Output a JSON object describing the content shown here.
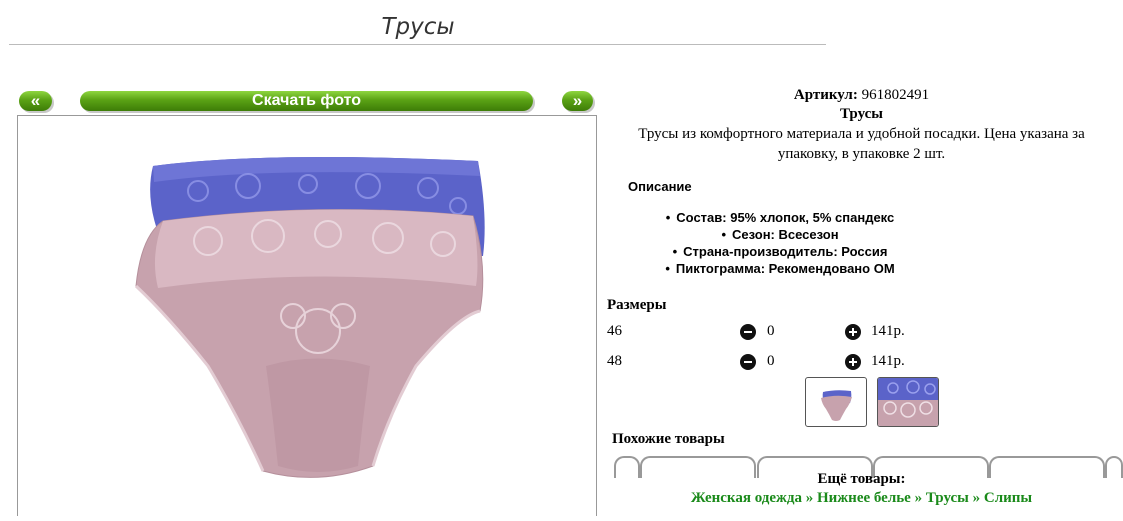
{
  "page": {
    "title": "Трусы"
  },
  "gallery": {
    "prev_label": "«",
    "download_label": "Скачать фото",
    "next_label": "»"
  },
  "product": {
    "article_label": "Артикул:",
    "article_value": "961802491",
    "name": "Трусы",
    "description": "Трусы из комфортного материала и удобной посадки. Цена указана за упаковку, в упаковке 2 шт.",
    "description_heading": "Описание",
    "properties": [
      "Состав: 95% хлопок, 5% спандекс",
      "Сезон: Всесезон",
      "Страна-производитель: Россия",
      "Пиктограмма: Рекомендовано ОМ"
    ]
  },
  "sizes": {
    "heading": "Размеры",
    "rows": [
      {
        "size": "46",
        "qty": "0",
        "price": "141р."
      },
      {
        "size": "48",
        "qty": "0",
        "price": "141р."
      }
    ]
  },
  "similar": {
    "heading": "Похожие товары"
  },
  "more": {
    "heading": "Ещё товары:",
    "links": [
      "Женская одежда",
      "Нижнее белье",
      "Трусы",
      "Слипы"
    ],
    "separator": "»"
  },
  "colors": {
    "button_green": "#5aa215",
    "link_green": "#1a8a1a"
  }
}
